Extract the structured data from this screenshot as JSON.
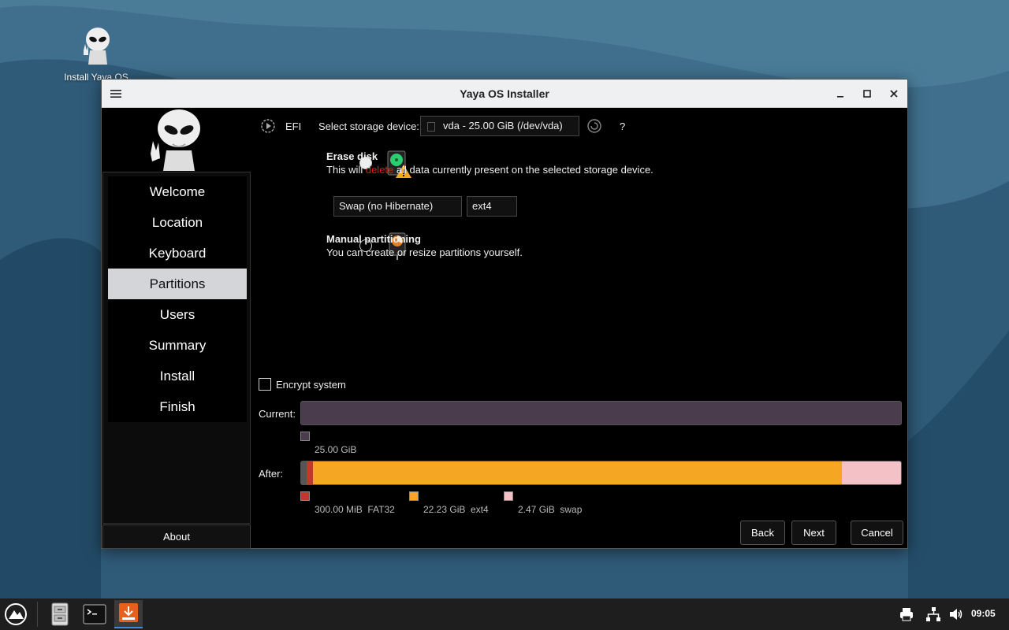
{
  "desktop": {
    "icon_label": "Install Yaya OS"
  },
  "window": {
    "title": "Yaya OS Installer"
  },
  "sidebar": {
    "items": [
      {
        "label": "Welcome"
      },
      {
        "label": "Location"
      },
      {
        "label": "Keyboard"
      },
      {
        "label": "Partitions",
        "active": true
      },
      {
        "label": "Users"
      },
      {
        "label": "Summary"
      },
      {
        "label": "Install"
      },
      {
        "label": "Finish"
      }
    ],
    "about_label": "About"
  },
  "partitions": {
    "boot_type": "EFI",
    "storage_label": "Select storage device:",
    "storage_value": "vda - 25.00 GiB (/dev/vda)",
    "help_label": "?",
    "erase": {
      "title": "Erase disk",
      "desc_prefix": "This will ",
      "desc_highlight": "delete",
      "desc_suffix": " all data currently present on the selected storage device.",
      "selected": true,
      "swap_option": "Swap (no Hibernate)",
      "fs_option": "ext4"
    },
    "manual": {
      "title": "Manual partitioning",
      "desc": "You can create or resize partitions yourself.",
      "selected": false
    },
    "encrypt_label": "Encrypt system",
    "current_label": "Current:",
    "current_size": "25.00 GiB",
    "after_label": "After:",
    "after_legend": [
      {
        "size": "300.00 MiB",
        "fs": "FAT32",
        "color": "#c0392b"
      },
      {
        "size": "22.23 GiB",
        "fs": "ext4",
        "color": "#f5a623"
      },
      {
        "size": "2.47 GiB",
        "fs": "swap",
        "color": "#f4c2c6"
      }
    ]
  },
  "buttons": {
    "back": "Back",
    "next": "Next",
    "cancel": "Cancel"
  },
  "taskbar": {
    "time": "09:05"
  },
  "colors": {
    "highlight_red": "#e0201b",
    "current_bar": "#4a3b4d",
    "fat32": "#c0392b",
    "ext4": "#f5a623",
    "swap": "#f4c2c6"
  }
}
